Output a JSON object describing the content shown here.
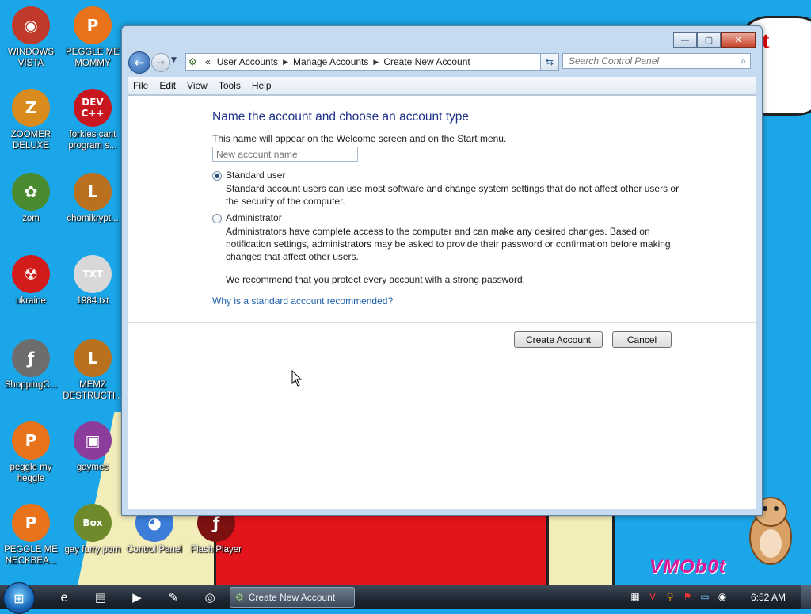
{
  "desktop": {
    "icons": [
      {
        "label": "WINDOWS VISTA",
        "glyph": "◉",
        "color": "#c0392b"
      },
      {
        "label": "PEGGLE ME MOMMY",
        "glyph": "P",
        "color": "#e8731a"
      },
      {
        "label": "ZOOMER DELUXE",
        "glyph": "Z",
        "color": "#d98b1d"
      },
      {
        "label": "forkies cant program s...",
        "glyph": "DEV C++",
        "color": "#c8171e"
      },
      {
        "label": "zom",
        "glyph": "✿",
        "color": "#4b8b2f"
      },
      {
        "label": "chomikrypt...",
        "glyph": "L",
        "color": "#b9701f"
      },
      {
        "label": "ukraine",
        "glyph": "☢",
        "color": "#d21b1b"
      },
      {
        "label": "1984.txt",
        "glyph": "TXT",
        "color": "#d8d8d8"
      },
      {
        "label": "ShoppingC...",
        "glyph": "ƒ",
        "color": "#6d6d6d"
      },
      {
        "label": "MEMZ DESTRUCTI...",
        "glyph": "L",
        "color": "#b9701f"
      },
      {
        "label": "peggle my heggle",
        "glyph": "P",
        "color": "#e8731a"
      },
      {
        "label": "gaymes",
        "glyph": "▣",
        "color": "#8c3d9b"
      },
      {
        "label": "PEGGLE ME NECKBEA...",
        "glyph": "P",
        "color": "#e8731a"
      },
      {
        "label": "gay furry porn",
        "glyph": "Box",
        "color": "#6e8a2a"
      },
      {
        "label": "Control Panel",
        "glyph": "◕",
        "color": "#3b7dd8"
      },
      {
        "label": "Flash Player",
        "glyph": "ƒ",
        "color": "#7d1010"
      }
    ],
    "watermark": "VMOb0t",
    "cloud_text": "t"
  },
  "window": {
    "close_symbol": "✕",
    "maximize_symbol": "▢",
    "minimize_symbol": "—",
    "address": {
      "prefix": "«",
      "crumbs": [
        "User Accounts",
        "Manage Accounts",
        "Create New Account"
      ]
    },
    "search_placeholder": "Search Control Panel",
    "menu": [
      "File",
      "Edit",
      "View",
      "Tools",
      "Help"
    ],
    "heading": "Name the account and choose an account type",
    "subtitle": "This name will appear on the Welcome screen and on the Start menu.",
    "name_placeholder": "New account name",
    "standard": {
      "label": "Standard user",
      "selected": true,
      "desc": "Standard account users can use most software and change system settings that do not affect other users or the security of the computer."
    },
    "admin": {
      "label": "Administrator",
      "selected": false,
      "desc": "Administrators have complete access to the computer and can make any desired changes. Based on notification settings, administrators may be asked to provide their password or confirmation before making changes that affect other users."
    },
    "recommend": "We recommend that you protect every account with a strong password.",
    "why_link": "Why is a standard account recommended?",
    "create_label": "Create Account",
    "cancel_label": "Cancel"
  },
  "taskbar": {
    "active_task": "Create New Account",
    "clock": "6:52 AM"
  }
}
